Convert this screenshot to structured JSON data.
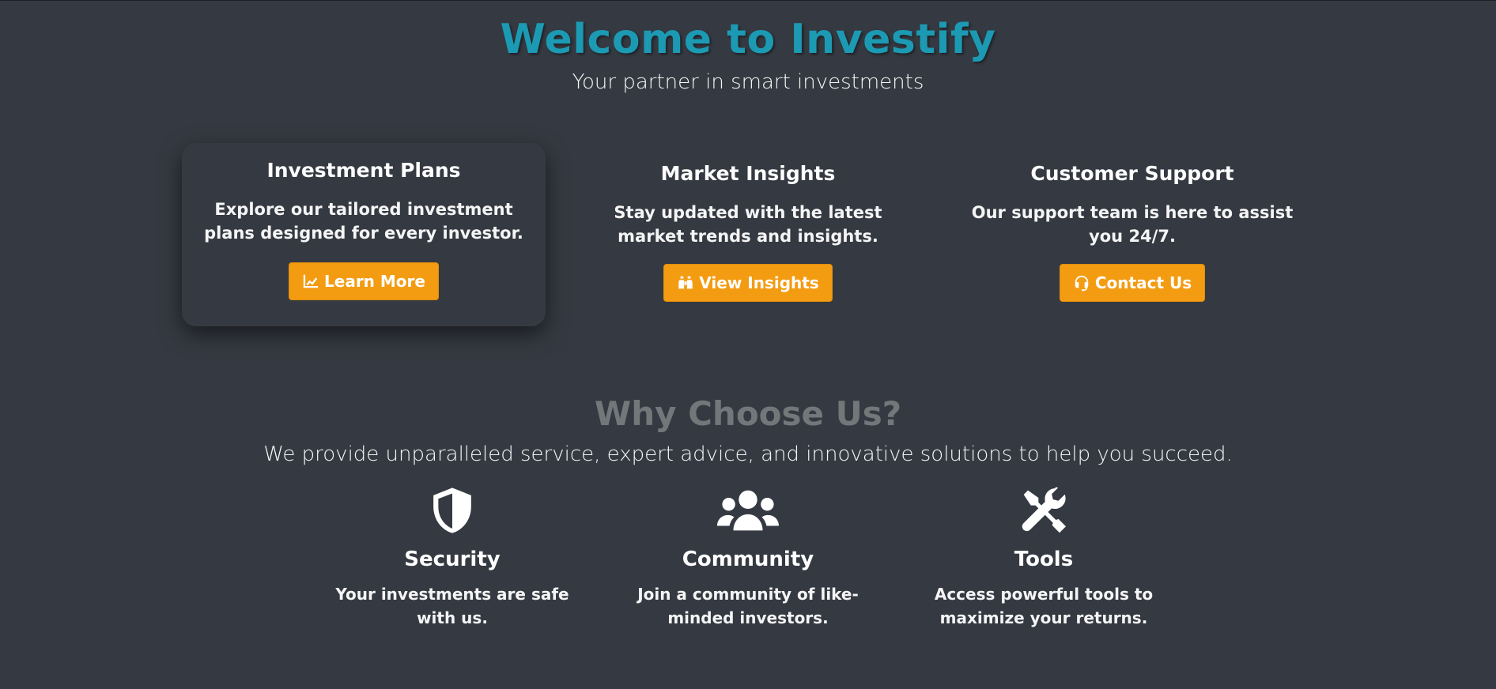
{
  "hero": {
    "title": "Welcome to Investify",
    "subtitle": "Your partner in smart investments"
  },
  "cards": [
    {
      "title": "Investment Plans",
      "text": "Explore our tailored investment plans designed for every investor.",
      "button_label": "Learn More",
      "button_icon": "chart-line-icon"
    },
    {
      "title": "Market Insights",
      "text": "Stay updated with the latest market trends and insights.",
      "button_label": "View Insights",
      "button_icon": "binoculars-icon"
    },
    {
      "title": "Customer Support",
      "text": "Our support team is here to assist you 24/7.",
      "button_label": "Contact Us",
      "button_icon": "headset-icon"
    }
  ],
  "why": {
    "title": "Why Choose Us?",
    "subtitle": "We provide unparalleled service, expert advice, and innovative solutions to help you succeed."
  },
  "features": [
    {
      "icon": "shield-icon",
      "title": "Security",
      "text": "Your investments are safe with us."
    },
    {
      "icon": "users-icon",
      "title": "Community",
      "text": "Join a community of like-minded investors."
    },
    {
      "icon": "tools-icon",
      "title": "Tools",
      "text": "Access powerful tools to maximize your returns."
    }
  ],
  "colors": {
    "background": "#353a42",
    "title_accent": "#1c9ab3",
    "button": "#f39c12",
    "section_heading": "#74777a"
  }
}
